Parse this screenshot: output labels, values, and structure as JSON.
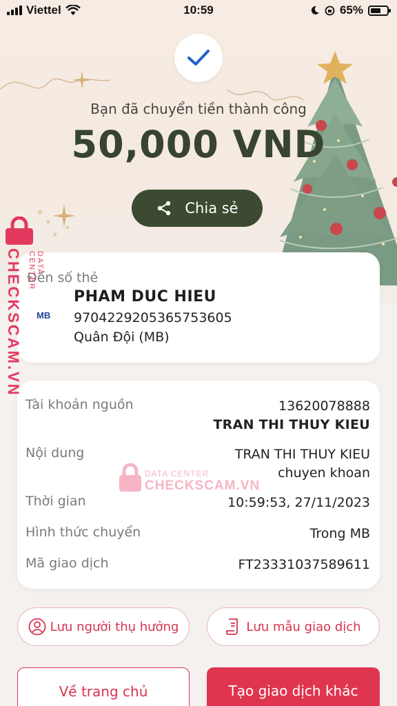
{
  "status_bar": {
    "carrier": "Viettel",
    "time": "10:59",
    "battery": "65%",
    "battery_level": 0.65
  },
  "header": {
    "subtitle": "Bạn đã chuyển tiền thành công",
    "amount": "50,000 VND",
    "share_label": "Chia sẻ"
  },
  "watermark": {
    "brand": "CHECKSCAM.VN",
    "tagline": "DATA CENTER"
  },
  "destination": {
    "label": "Đến số thẻ",
    "bank_logo": "MB",
    "name": "PHAM DUC HIEU",
    "card_number": "9704229205365753605",
    "bank": "Quân Đội (MB)"
  },
  "details": {
    "source_label": "Tài khoản nguồn",
    "source_account": "13620078888",
    "source_name": "TRAN THI THUY KIEU",
    "content_label": "Nội dung",
    "content_line1": "TRAN THI THUY KIEU",
    "content_line2": "chuyen khoan",
    "time_label": "Thời gian",
    "time_value": "10:59:53, 27/11/2023",
    "method_label": "Hình thức chuyển",
    "method_value": "Trong MB",
    "txn_label": "Mã giao dịch",
    "txn_value": "FT23331037589611"
  },
  "actions": {
    "save_beneficiary": "Lưu người thụ hưởng",
    "save_template": "Lưu mẫu giao dịch",
    "home": "Về trang chủ",
    "new_transaction": "Tạo giao dịch khác"
  },
  "colors": {
    "accent": "#e0354f",
    "dark_green": "#3b4a31",
    "amount_green": "#37442f"
  }
}
